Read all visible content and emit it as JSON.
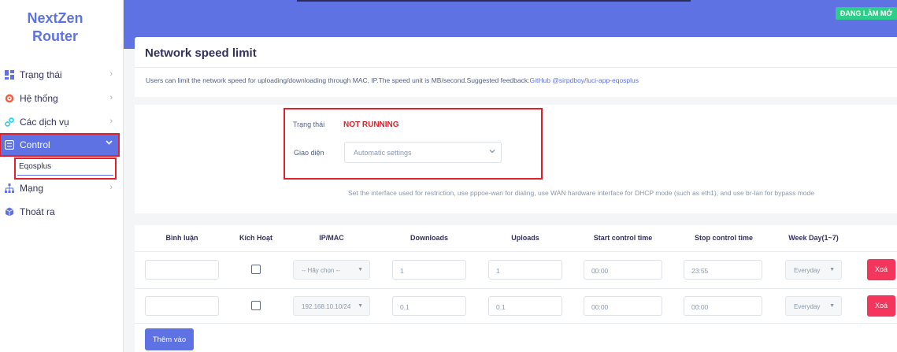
{
  "brand": {
    "line1": "NextZen",
    "line2": "Router"
  },
  "sidebar": {
    "items": [
      {
        "label": "Trạng thái",
        "icon": "dashboard-icon"
      },
      {
        "label": "Hệ thống",
        "icon": "gear-icon"
      },
      {
        "label": "Các dịch vụ",
        "icon": "services-icon"
      },
      {
        "label": "Control",
        "icon": "control-icon"
      },
      {
        "label": "Mạng",
        "icon": "network-icon"
      },
      {
        "label": "Thoát ra",
        "icon": "logout-icon"
      }
    ],
    "submenu": {
      "label": "Eqosplus"
    }
  },
  "topbar": {
    "badge": "ĐANG LÀM MỚ"
  },
  "page": {
    "title": "Network speed limit",
    "description": "Users can limit the network speed for uploading/downloading through MAC, IP.The speed unit is MB/second.Suggested feedback:",
    "link": "GitHub @sirpdboy/luci-app-eqosplus"
  },
  "settings": {
    "status_label": "Trạng thái",
    "status_value": "NOT RUNNING",
    "interface_label": "Giao diện",
    "interface_value": "Automatic settings",
    "interface_help": "Set the interface used for restriction, use pppoe-wan for dialing, use WAN hardware interface for DHCP mode (such as eth1), and use br-lan for bypass mode"
  },
  "table": {
    "headers": [
      "Bình luận",
      "Kích Hoạt",
      "IP/MAC",
      "Downloads",
      "Uploads",
      "Start control time",
      "Stop control time",
      "Week Day(1~7)"
    ],
    "rows": [
      {
        "comment": "",
        "enabled": false,
        "ipmac": "-- Hãy chọn --",
        "downloads": "1",
        "uploads": "1",
        "start": "00:00",
        "stop": "23:55",
        "weekday": "Everyday",
        "delete": "Xoá"
      },
      {
        "comment": "",
        "enabled": false,
        "ipmac": "192.168.10.10/24",
        "downloads": "0.1",
        "uploads": "0.1",
        "start": "00:00",
        "stop": "00:00",
        "weekday": "Everyday",
        "delete": "Xoá"
      }
    ],
    "add_label": "Thêm vào"
  },
  "colors": {
    "accent": "#5e72e4",
    "danger": "#f5365c",
    "success": "#2dce89",
    "highlight": "#e0212c"
  }
}
